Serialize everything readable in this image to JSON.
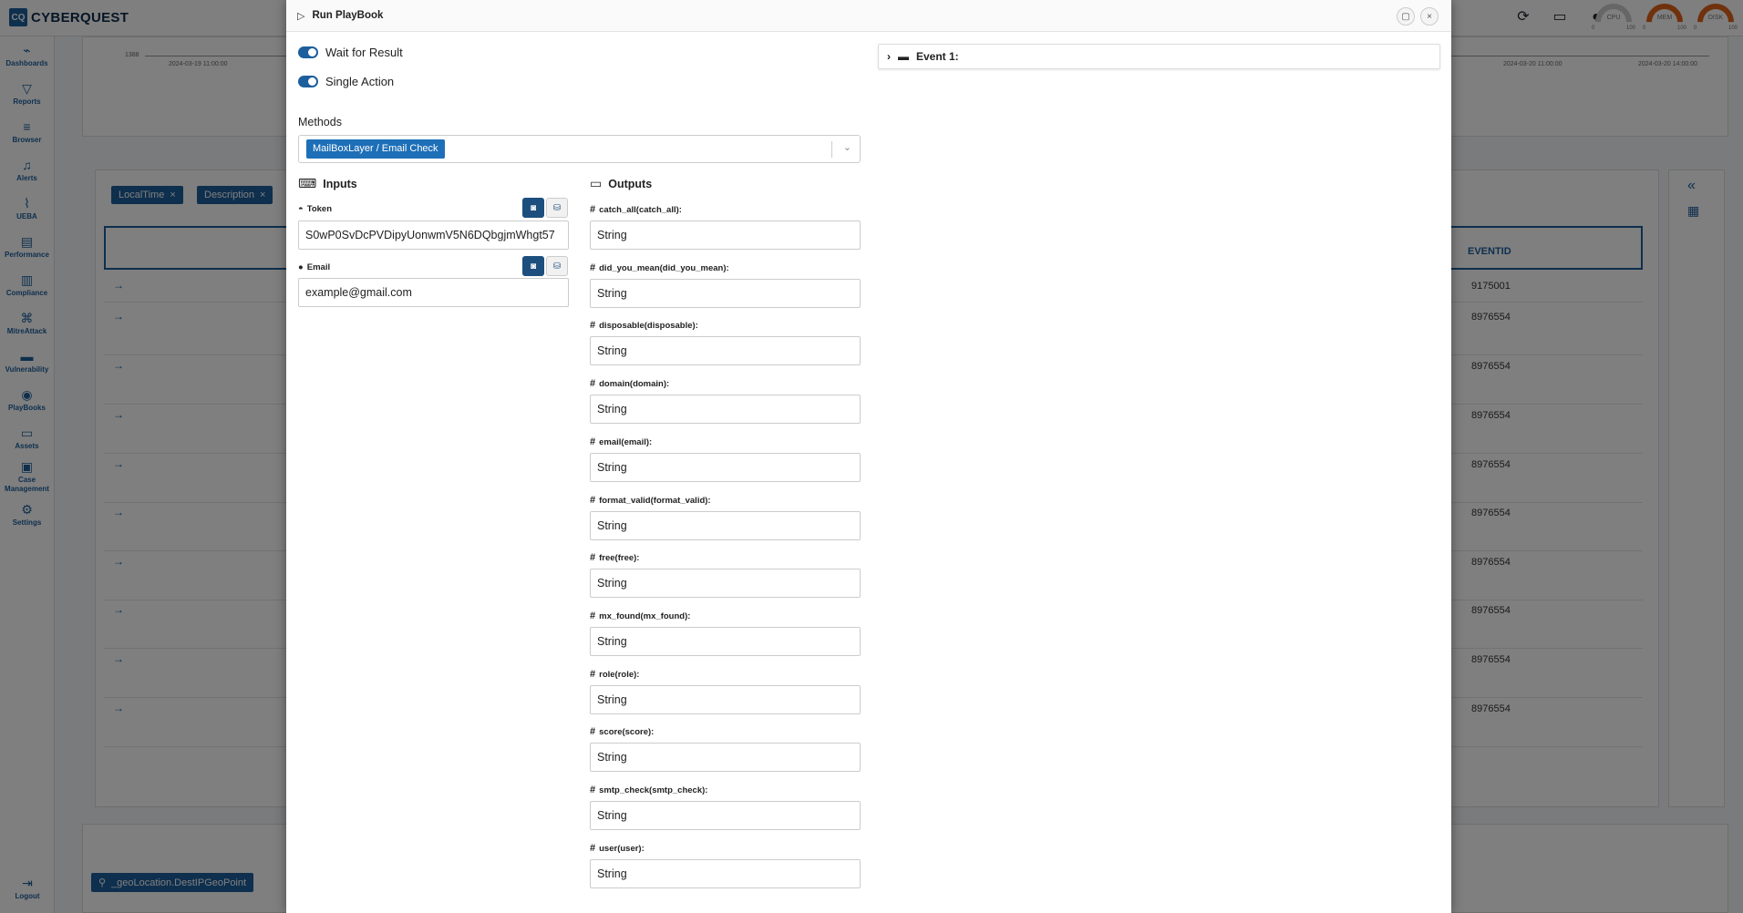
{
  "app": {
    "logo_mark": "CQ",
    "logo_text": "CYBERQUEST"
  },
  "topbar": {
    "icons": [
      "refresh-icon",
      "monitor-icon",
      "user-icon"
    ],
    "gauges": [
      {
        "label": "CPU",
        "min": "0",
        "max": "100"
      },
      {
        "label": "MEM",
        "min": "0",
        "max": "100"
      },
      {
        "label": "DISK",
        "min": "0",
        "max": "100"
      }
    ]
  },
  "sidebar": {
    "items": [
      {
        "icon": "dashboards-icon",
        "label": "Dashboards"
      },
      {
        "icon": "reports-icon",
        "label": "Reports"
      },
      {
        "icon": "browser-icon",
        "label": "Browser"
      },
      {
        "icon": "alerts-icon",
        "label": "Alerts"
      },
      {
        "icon": "ueba-icon",
        "label": "UEBA"
      },
      {
        "icon": "performance-icon",
        "label": "Performance"
      },
      {
        "icon": "compliance-icon",
        "label": "Compliance"
      },
      {
        "icon": "mitreattack-icon",
        "label": "MitreAttack"
      },
      {
        "icon": "vulnerability-icon",
        "label": "Vulnerability"
      },
      {
        "icon": "playbooks-icon",
        "label": "PlayBooks"
      },
      {
        "icon": "assets-icon",
        "label": "Assets"
      },
      {
        "icon": "case-management-icon",
        "label": "Case Management"
      },
      {
        "icon": "settings-icon",
        "label": "Settings"
      }
    ],
    "logout": "Logout"
  },
  "background": {
    "chart_y_tick": "1388",
    "chart_x_ticks": [
      "2024-03-19 11:00:00",
      "2024-03-20 11:00:00",
      "2024-03-20 14:00:00"
    ],
    "filter_pills": [
      "LocalTime",
      "Description"
    ],
    "event_column": "EVENTID",
    "event_ids": [
      "9175001",
      "8976554",
      "8976554",
      "8976554",
      "8976554",
      "8976554",
      "8976554",
      "8976554",
      "8976554",
      "8976554"
    ],
    "geo_pill": "_geoLocation.DestIPGeoPoint"
  },
  "modal": {
    "title": "Run PlayBook",
    "wait_for_result": "Wait for Result",
    "single_action": "Single Action",
    "methods_label": "Methods",
    "method_selected": "MailBoxLayer / Email Check",
    "inputs_title": "Inputs",
    "outputs_title": "Outputs",
    "inputs": [
      {
        "label": "Token",
        "value": "S0wP0SvDcPVDipyUonwmV5N6DQbgjmWhgt57"
      },
      {
        "label": "Email",
        "value": "example@gmail.com"
      }
    ],
    "outputs": [
      {
        "label": "catch_all(catch_all):",
        "value": "String"
      },
      {
        "label": "did_you_mean(did_you_mean):",
        "value": "String"
      },
      {
        "label": "disposable(disposable):",
        "value": "String"
      },
      {
        "label": "domain(domain):",
        "value": "String"
      },
      {
        "label": "email(email):",
        "value": "String"
      },
      {
        "label": "format_valid(format_valid):",
        "value": "String"
      },
      {
        "label": "free(free):",
        "value": "String"
      },
      {
        "label": "mx_found(mx_found):",
        "value": "String"
      },
      {
        "label": "role(role):",
        "value": "String"
      },
      {
        "label": "score(score):",
        "value": "String"
      },
      {
        "label": "smtp_check(smtp_check):",
        "value": "String"
      },
      {
        "label": "user(user):",
        "value": "String"
      }
    ],
    "event_label": "Event 1:"
  }
}
